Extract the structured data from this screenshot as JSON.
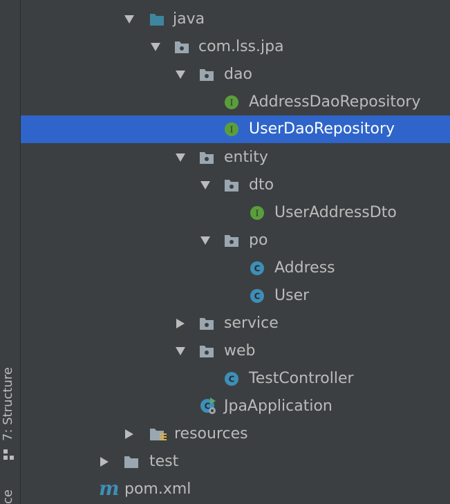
{
  "sidebar": {
    "structure_tab": "7: Structure",
    "cut_tab": "ce"
  },
  "tree": {
    "nodes": [
      {
        "label": "java",
        "type": "folder-source",
        "expanded": true
      },
      {
        "label": "com.lss.jpa",
        "type": "package",
        "expanded": true
      },
      {
        "label": "dao",
        "type": "package",
        "expanded": true
      },
      {
        "label": "AddressDaoRepository",
        "type": "interface"
      },
      {
        "label": "UserDaoRepository",
        "type": "interface",
        "selected": true
      },
      {
        "label": "entity",
        "type": "package",
        "expanded": true
      },
      {
        "label": "dto",
        "type": "package",
        "expanded": true
      },
      {
        "label": "UserAddressDto",
        "type": "interface"
      },
      {
        "label": "po",
        "type": "package",
        "expanded": true
      },
      {
        "label": "Address",
        "type": "class"
      },
      {
        "label": "User",
        "type": "class"
      },
      {
        "label": "service",
        "type": "package",
        "expanded": false
      },
      {
        "label": "web",
        "type": "package",
        "expanded": true
      },
      {
        "label": "TestController",
        "type": "class"
      },
      {
        "label": "JpaApplication",
        "type": "spring-boot-class"
      },
      {
        "label": "resources",
        "type": "folder-resources",
        "expanded": false
      },
      {
        "label": "test",
        "type": "folder",
        "expanded": false
      },
      {
        "label": "pom.xml",
        "type": "maven-file"
      }
    ]
  },
  "colors": {
    "background": "#3c3f41",
    "selection": "#2f65ca",
    "text": "#bbbbbb",
    "interface_icon": "#5a9e3c",
    "class_icon": "#3d8fb8",
    "folder": "#9aa7b0",
    "source_folder": "#3e86a0"
  }
}
